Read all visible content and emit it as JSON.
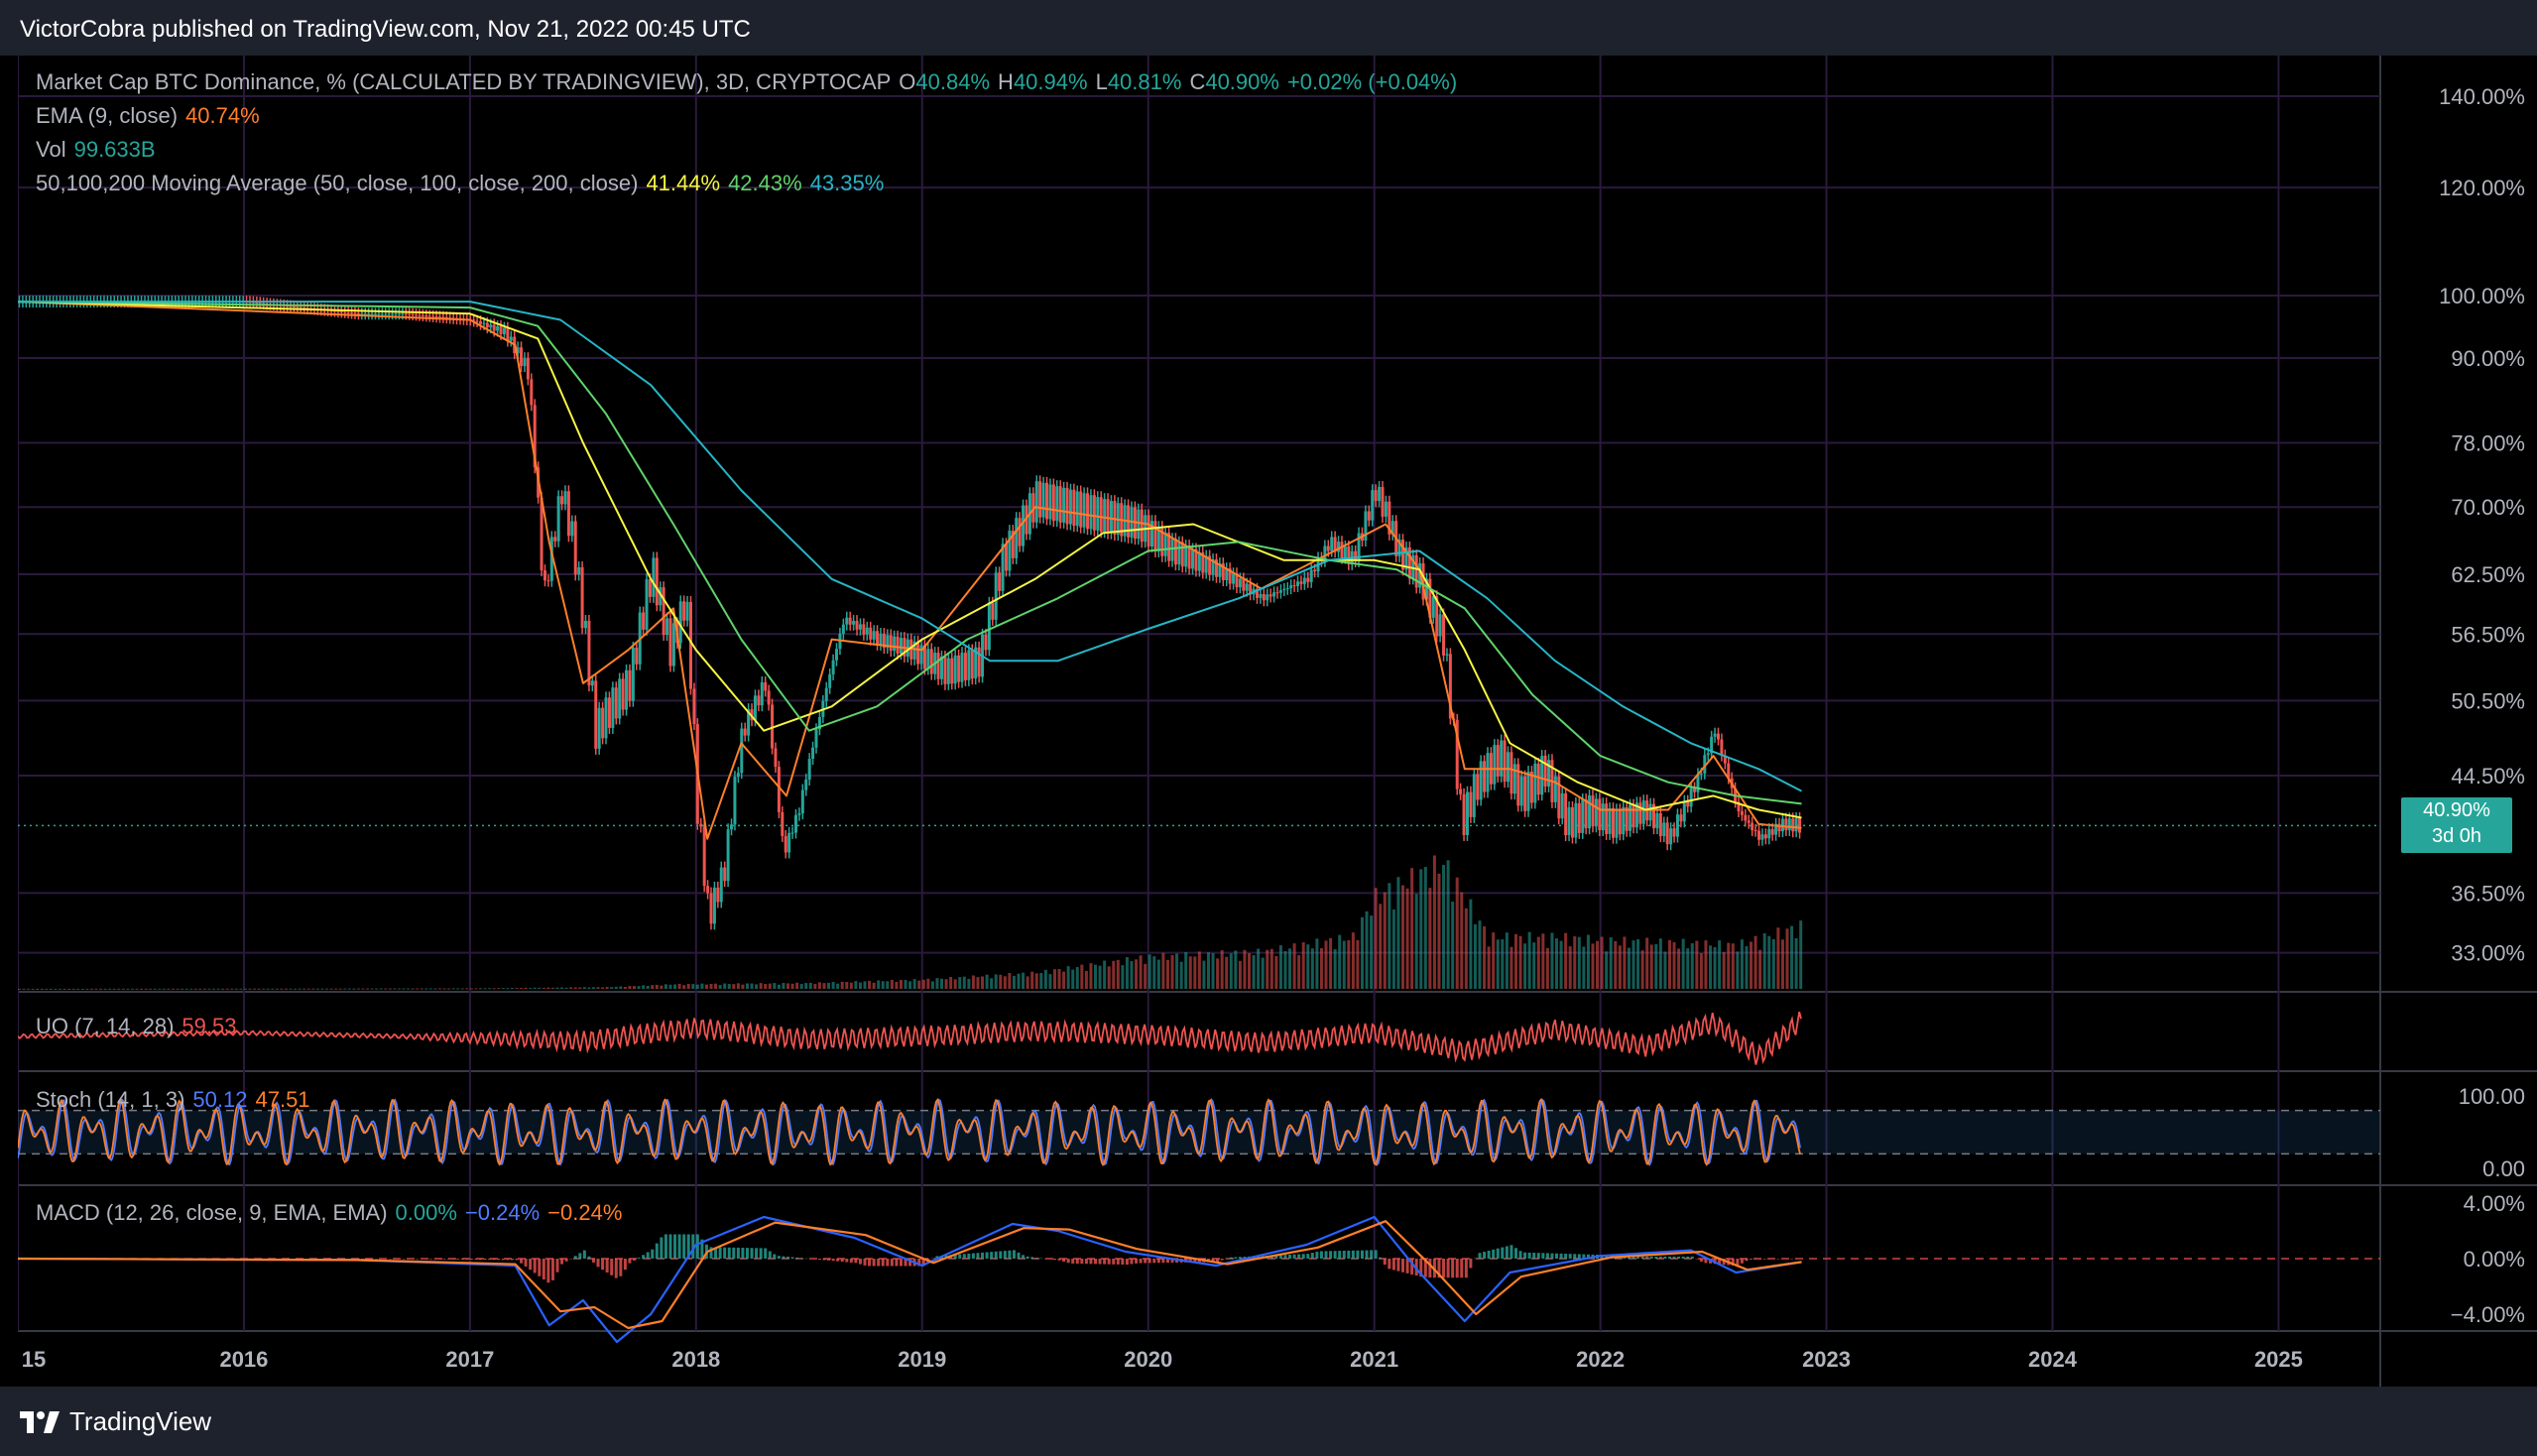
{
  "header": {
    "publisher": "VictorCobra published on TradingView.com, Nov 21, 2022 00:45 UTC"
  },
  "footer": {
    "brand": "TradingView",
    "logo_icon": "tradingview-logo-icon"
  },
  "legend": {
    "main": {
      "title": "Market Cap BTC Dominance, % (CALCULATED BY TRADINGVIEW), 3D, CRYPTOCAP",
      "o_label": "O",
      "o_value": "40.84%",
      "h_label": "H",
      "h_value": "40.94%",
      "l_label": "L",
      "l_value": "40.81%",
      "c_label": "C",
      "c_value": "40.90%",
      "change": "+0.02% (+0.04%)"
    },
    "ema": {
      "label": "EMA (9, close)",
      "value": "40.74%"
    },
    "vol": {
      "label": "Vol",
      "value": "99.633B"
    },
    "ma": {
      "label": "50,100,200 Moving Average (50, close, 100, close, 200, close)",
      "v1": "41.44%",
      "v2": "42.43%",
      "v3": "43.35%"
    },
    "uo": {
      "label": "UO (7, 14, 28)",
      "value": "59.53"
    },
    "stoch": {
      "label": "Stoch (14, 1, 3)",
      "k": "50.12",
      "d": "47.51"
    },
    "macd": {
      "label": "MACD (12, 26, close, 9, EMA, EMA)",
      "hist": "0.00%",
      "macd": "−0.24%",
      "signal": "−0.24%"
    }
  },
  "price_badge": {
    "value": "40.90%",
    "countdown": "3d 0h"
  },
  "colors": {
    "up": "#26a69a",
    "down": "#ef5350",
    "ema": "#ff7f2a",
    "ma50": "#f5f542",
    "ma100": "#5fd36a",
    "ma200": "#26b5c5",
    "grid": "#2a1a3d",
    "axis_text": "#b2b5be"
  },
  "chart_data": [
    {
      "type": "line",
      "title": "Market Cap BTC Dominance, % (CALCULATED BY TRADINGVIEW), 3D, CRYPTOCAP",
      "scale": "log",
      "y_ticks": [
        "140.00%",
        "120.00%",
        "100.00%",
        "90.00%",
        "78.00%",
        "70.00%",
        "62.50%",
        "56.50%",
        "50.50%",
        "44.50%",
        "36.50%",
        "33.00%"
      ],
      "y_tick_values": [
        140,
        120,
        100,
        90,
        78,
        70,
        62.5,
        56.5,
        50.5,
        44.5,
        36.5,
        33
      ],
      "x_ticks": [
        "15",
        "2016",
        "2017",
        "2018",
        "2019",
        "2020",
        "2021",
        "2022",
        "2023",
        "2024",
        "2025"
      ],
      "x_tick_years": [
        2015,
        2016,
        2017,
        2018,
        2019,
        2020,
        2021,
        2022,
        2023,
        2024,
        2025
      ],
      "x_range": [
        2015.0,
        2025.45
      ],
      "y_range": [
        31,
        145
      ],
      "series": [
        {
          "name": "Market Cap BTC Dominance",
          "x": [
            2015.0,
            2016.0,
            2016.5,
            2016.7,
            2017.0,
            2017.15,
            2017.25,
            2017.32,
            2017.4,
            2017.45,
            2017.55,
            2017.62,
            2017.7,
            2017.8,
            2017.88,
            2017.95,
            2018.0,
            2018.05,
            2018.12,
            2018.2,
            2018.3,
            2018.38,
            2018.45,
            2018.55,
            2018.65,
            2018.8,
            2018.95,
            2019.1,
            2019.25,
            2019.35,
            2019.5,
            2019.65,
            2019.8,
            2019.95,
            2020.1,
            2020.3,
            2020.5,
            2020.7,
            2020.8,
            2020.9,
            2021.0,
            2021.05,
            2021.1,
            2021.2,
            2021.3,
            2021.38,
            2021.45,
            2021.55,
            2021.65,
            2021.75,
            2021.85,
            2021.95,
            2022.05,
            2022.2,
            2022.3,
            2022.42,
            2022.5,
            2022.6,
            2022.7,
            2022.8,
            2022.89
          ],
          "y": [
            99,
            99,
            97,
            97,
            96,
            94,
            88,
            60,
            72,
            66,
            48,
            50,
            52,
            63,
            55,
            60,
            42,
            35,
            38,
            48,
            52,
            39,
            42,
            50,
            58,
            56,
            55,
            53,
            54,
            64,
            71,
            70,
            69,
            68,
            65,
            63,
            60,
            62,
            66,
            64,
            72,
            69,
            65,
            62,
            56,
            41,
            44,
            46,
            43,
            45,
            41,
            42,
            41,
            42,
            40,
            44,
            48,
            42,
            40,
            41,
            40.9
          ]
        },
        {
          "name": "EMA (9, close)",
          "x": [
            2015.0,
            2017.0,
            2017.2,
            2017.35,
            2017.5,
            2017.7,
            2017.9,
            2018.05,
            2018.2,
            2018.4,
            2018.6,
            2019.0,
            2019.5,
            2020.0,
            2020.5,
            2020.9,
            2021.05,
            2021.2,
            2021.4,
            2021.6,
            2021.8,
            2022.0,
            2022.3,
            2022.5,
            2022.7,
            2022.89
          ],
          "y": [
            99,
            96,
            92,
            66,
            52,
            55,
            59,
            40,
            47,
            43,
            56,
            55,
            70,
            68,
            61,
            66,
            68,
            63,
            45,
            45,
            44,
            42,
            42,
            46,
            41,
            40.74
          ]
        },
        {
          "name": "Moving Average 50",
          "x": [
            2015.0,
            2017.0,
            2017.3,
            2017.5,
            2017.8,
            2018.0,
            2018.3,
            2018.6,
            2019.0,
            2019.5,
            2019.8,
            2020.2,
            2020.6,
            2021.0,
            2021.2,
            2021.4,
            2021.6,
            2021.9,
            2022.2,
            2022.5,
            2022.7,
            2022.89
          ],
          "y": [
            99,
            97,
            93,
            78,
            62,
            55,
            48,
            50,
            56,
            62,
            67,
            68,
            64,
            64,
            63,
            55,
            47,
            44,
            42,
            43,
            42,
            41.44
          ]
        },
        {
          "name": "Moving Average 100",
          "x": [
            2015.0,
            2017.0,
            2017.3,
            2017.6,
            2017.9,
            2018.2,
            2018.5,
            2018.8,
            2019.2,
            2019.6,
            2020.0,
            2020.4,
            2020.8,
            2021.1,
            2021.4,
            2021.7,
            2022.0,
            2022.3,
            2022.6,
            2022.89
          ],
          "y": [
            99,
            98,
            95,
            82,
            68,
            56,
            48,
            50,
            56,
            60,
            65,
            66,
            64,
            63,
            59,
            51,
            46,
            44,
            43,
            42.43
          ]
        },
        {
          "name": "Moving Average 200",
          "x": [
            2015.0,
            2017.0,
            2017.4,
            2017.8,
            2018.2,
            2018.6,
            2019.0,
            2019.3,
            2019.6,
            2020.0,
            2020.4,
            2020.8,
            2021.2,
            2021.5,
            2021.8,
            2022.1,
            2022.4,
            2022.7,
            2022.89
          ],
          "y": [
            99,
            99,
            96,
            86,
            72,
            62,
            58,
            54,
            54,
            57,
            60,
            64,
            65,
            60,
            54,
            50,
            47,
            45,
            43.35
          ]
        }
      ],
      "last_value": 40.9
    },
    {
      "type": "bar",
      "title": "Vol",
      "series": [
        {
          "name": "Vol",
          "x": [
            2015.0,
            2016.0,
            2017.0,
            2017.6,
            2017.9,
            2018.5,
            2019.0,
            2019.5,
            2020.0,
            2020.5,
            2020.9,
            2021.0,
            2021.3,
            2021.5,
            2021.8,
            2022.0,
            2022.3,
            2022.6,
            2022.89
          ],
          "y": [
            0.1,
            0.2,
            0.5,
            1.5,
            4,
            5,
            8,
            14,
            28,
            32,
            45,
            80,
            110,
            45,
            45,
            42,
            40,
            38,
            55
          ]
        }
      ]
    },
    {
      "type": "line",
      "title": "UO (7, 14, 28)",
      "series": [
        {
          "name": "UO",
          "x": [
            2015.0,
            2016.0,
            2017.0,
            2017.5,
            2018.0,
            2018.5,
            2019.0,
            2019.5,
            2020.0,
            2020.5,
            2021.0,
            2021.4,
            2021.8,
            2022.2,
            2022.5,
            2022.7,
            2022.89
          ],
          "y": [
            50,
            52,
            49,
            47,
            55,
            48,
            50,
            53,
            51,
            46,
            52,
            41,
            54,
            44,
            58,
            38,
            59.53
          ]
        }
      ]
    },
    {
      "type": "line",
      "title": "Stoch (14, 1, 3)",
      "y_ticks": [
        "100.00",
        "0.00"
      ],
      "series": [
        {
          "name": "%K",
          "x": [
            2015.0,
            2016.0,
            2017.0,
            2018.0,
            2019.0,
            2020.0,
            2021.0,
            2022.0,
            2022.89
          ],
          "y": [
            50,
            60,
            45,
            55,
            65,
            40,
            55,
            50,
            50.12
          ]
        },
        {
          "name": "%D",
          "x": [
            2015.0,
            2016.0,
            2017.0,
            2018.0,
            2019.0,
            2020.0,
            2021.0,
            2022.0,
            2022.89
          ],
          "y": [
            48,
            58,
            47,
            53,
            62,
            42,
            52,
            48,
            47.51
          ]
        }
      ]
    },
    {
      "type": "line",
      "title": "MACD (12, 26, close, 9, EMA, EMA)",
      "y_ticks": [
        "4.00%",
        "0.00%",
        "−4.00%"
      ],
      "series": [
        {
          "name": "MACD",
          "x": [
            2015.0,
            2016.5,
            2017.2,
            2017.35,
            2017.5,
            2017.65,
            2017.8,
            2018.0,
            2018.3,
            2018.7,
            2019.0,
            2019.4,
            2019.6,
            2019.9,
            2020.3,
            2020.7,
            2021.0,
            2021.2,
            2021.4,
            2021.6,
            2022.0,
            2022.4,
            2022.6,
            2022.89
          ],
          "y": [
            0,
            -0.1,
            -0.5,
            -4.8,
            -3,
            -6,
            -4,
            1,
            3,
            1.5,
            -0.5,
            2.5,
            2.0,
            0.5,
            -0.5,
            1,
            3.0,
            -1,
            -4.5,
            -1,
            0.2,
            0.6,
            -1.0,
            -0.24
          ]
        },
        {
          "name": "Signal",
          "x": [
            2015.0,
            2016.5,
            2017.2,
            2017.4,
            2017.55,
            2017.7,
            2017.85,
            2018.05,
            2018.35,
            2018.75,
            2019.05,
            2019.45,
            2019.65,
            2019.95,
            2020.35,
            2020.75,
            2021.05,
            2021.25,
            2021.45,
            2021.65,
            2022.05,
            2022.45,
            2022.65,
            2022.89
          ],
          "y": [
            0,
            -0.1,
            -0.4,
            -3.8,
            -3.5,
            -5,
            -4.5,
            0.5,
            2.6,
            1.7,
            -0.3,
            2.2,
            2.1,
            0.7,
            -0.4,
            0.8,
            2.7,
            -0.5,
            -4.0,
            -1.3,
            0.1,
            0.5,
            -0.8,
            -0.24
          ]
        }
      ]
    }
  ]
}
